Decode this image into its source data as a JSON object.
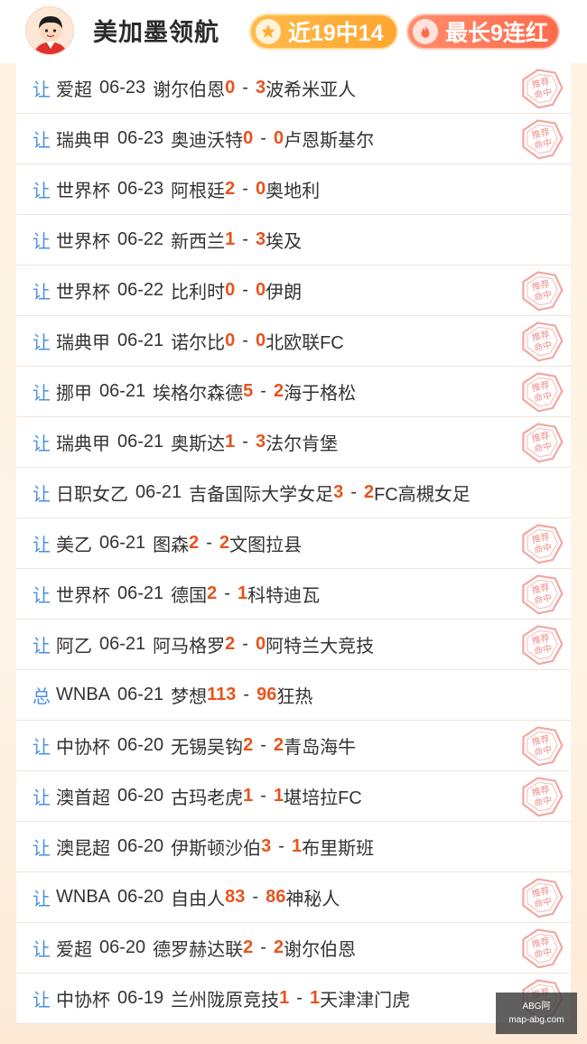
{
  "header": {
    "expert_name": "美加墨领航",
    "recent_record": "近19中14",
    "longest_streak": "最长9连红"
  },
  "stamp_text": "推荐命中",
  "watermark": [
    "ABG阿",
    "map-abg.com"
  ],
  "matches": [
    {
      "type": "让",
      "league": "爱超",
      "date": "06-23",
      "home": "谢尔伯恩",
      "home_score": "0",
      "away_score": "3",
      "away": "波希米亚人",
      "hit": true
    },
    {
      "type": "让",
      "league": "瑞典甲",
      "date": "06-23",
      "home": "奥迪沃特",
      "home_score": "0",
      "away_score": "0",
      "away": "卢恩斯基尔",
      "hit": true
    },
    {
      "type": "让",
      "league": "世界杯",
      "date": "06-23",
      "home": "阿根廷",
      "home_score": "2",
      "away_score": "0",
      "away": "奥地利",
      "hit": false
    },
    {
      "type": "让",
      "league": "世界杯",
      "date": "06-22",
      "home": "新西兰",
      "home_score": "1",
      "away_score": "3",
      "away": "埃及",
      "hit": false
    },
    {
      "type": "让",
      "league": "世界杯",
      "date": "06-22",
      "home": "比利时",
      "home_score": "0",
      "away_score": "0",
      "away": "伊朗",
      "hit": true
    },
    {
      "type": "让",
      "league": "瑞典甲",
      "date": "06-21",
      "home": "诺尔比",
      "home_score": "0",
      "away_score": "0",
      "away": "北欧联FC",
      "hit": true
    },
    {
      "type": "让",
      "league": "挪甲",
      "date": "06-21",
      "home": "埃格尔森德",
      "home_score": "5",
      "away_score": "2",
      "away": "海于格松",
      "hit": true
    },
    {
      "type": "让",
      "league": "瑞典甲",
      "date": "06-21",
      "home": "奥斯达",
      "home_score": "1",
      "away_score": "3",
      "away": "法尔肯堡",
      "hit": true
    },
    {
      "type": "让",
      "league": "日职女乙",
      "date": "06-21",
      "home": "吉备国际大学女足",
      "home_score": "3",
      "away_score": "2",
      "away": "FC高槻女足",
      "hit": false
    },
    {
      "type": "让",
      "league": "美乙",
      "date": "06-21",
      "home": "图森",
      "home_score": "2",
      "away_score": "2",
      "away": "文图拉县",
      "hit": true
    },
    {
      "type": "让",
      "league": "世界杯",
      "date": "06-21",
      "home": "德国",
      "home_score": "2",
      "away_score": "1",
      "away": "科特迪瓦",
      "hit": true
    },
    {
      "type": "让",
      "league": "阿乙",
      "date": "06-21",
      "home": "阿马格罗",
      "home_score": "2",
      "away_score": "0",
      "away": "阿特兰大竞技",
      "hit": true
    },
    {
      "type": "总",
      "league": "WNBA",
      "date": "06-21",
      "home": "梦想",
      "home_score": "113",
      "away_score": "96",
      "away": "狂热",
      "hit": false
    },
    {
      "type": "让",
      "league": "中协杯",
      "date": "06-20",
      "home": "无锡吴钩",
      "home_score": "2",
      "away_score": "2",
      "away": "青岛海牛",
      "hit": true
    },
    {
      "type": "让",
      "league": "澳首超",
      "date": "06-20",
      "home": "古玛老虎",
      "home_score": "1",
      "away_score": "1",
      "away": "堪培拉FC",
      "hit": true
    },
    {
      "type": "让",
      "league": "澳昆超",
      "date": "06-20",
      "home": "伊斯顿沙伯",
      "home_score": "3",
      "away_score": "1",
      "away": "布里斯班",
      "hit": false
    },
    {
      "type": "让",
      "league": "WNBA",
      "date": "06-20",
      "home": "自由人",
      "home_score": "83",
      "away_score": "86",
      "away": "神秘人",
      "hit": true
    },
    {
      "type": "让",
      "league": "爱超",
      "date": "06-20",
      "home": "德罗赫达联",
      "home_score": "2",
      "away_score": "2",
      "away": "谢尔伯恩",
      "hit": true
    },
    {
      "type": "让",
      "league": "中协杯",
      "date": "06-19",
      "home": "兰州陇原竞技",
      "home_score": "1",
      "away_score": "1",
      "away": "天津津门虎",
      "hit": true
    }
  ]
}
